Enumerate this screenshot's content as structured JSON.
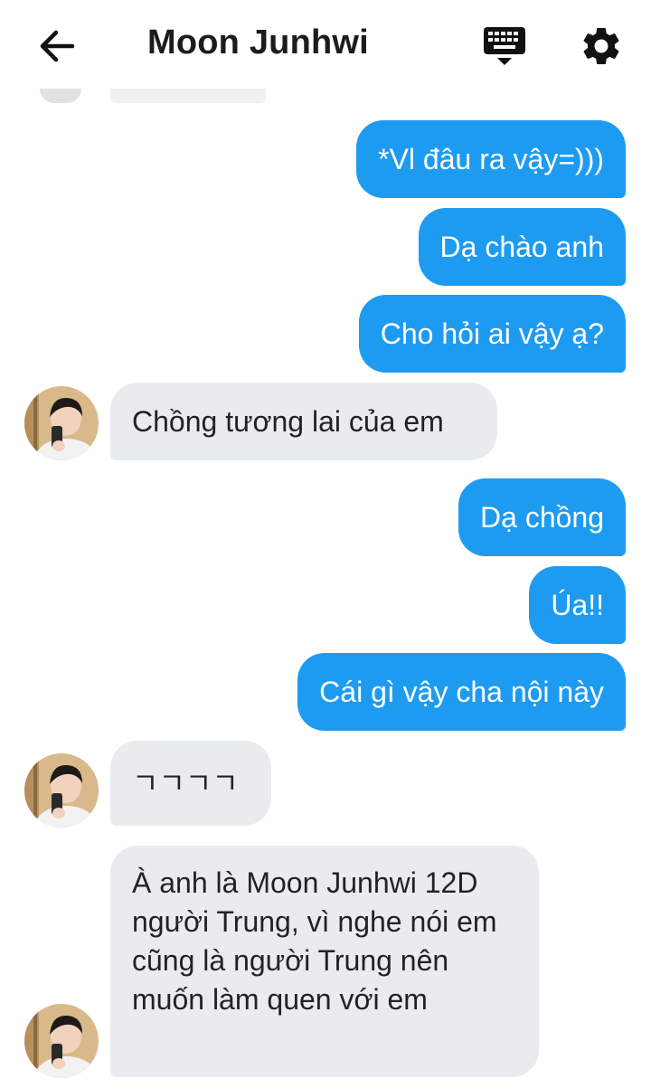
{
  "header": {
    "title": "Moon Junhwi",
    "back_icon": "arrow-left-icon",
    "keyboard_icon": "keyboard-icon",
    "settings_icon": "gear-icon"
  },
  "colors": {
    "outgoing_bubble": "#1d9bf0",
    "incoming_bubble": "#e9ecef"
  },
  "messages": [
    {
      "from": "me",
      "text": "*Vl đâu ra vậy=)))"
    },
    {
      "from": "me",
      "text": "Dạ chào anh"
    },
    {
      "from": "me",
      "text": "Cho hỏi ai vậy ạ?"
    },
    {
      "from": "them",
      "text": "Chồng tương lai của em"
    },
    {
      "from": "me",
      "text": "Dạ chồng"
    },
    {
      "from": "me",
      "text": "Úa!!"
    },
    {
      "from": "me",
      "text": "Cái gì vậy cha nội này"
    },
    {
      "from": "them",
      "text": "ㄱㄱㄱㄱ"
    },
    {
      "from": "them",
      "text": "À anh là Moon Junhwi 12D người Trung, vì nghe nói em cũng là người  Trung nên muốn làm quen với em"
    }
  ]
}
